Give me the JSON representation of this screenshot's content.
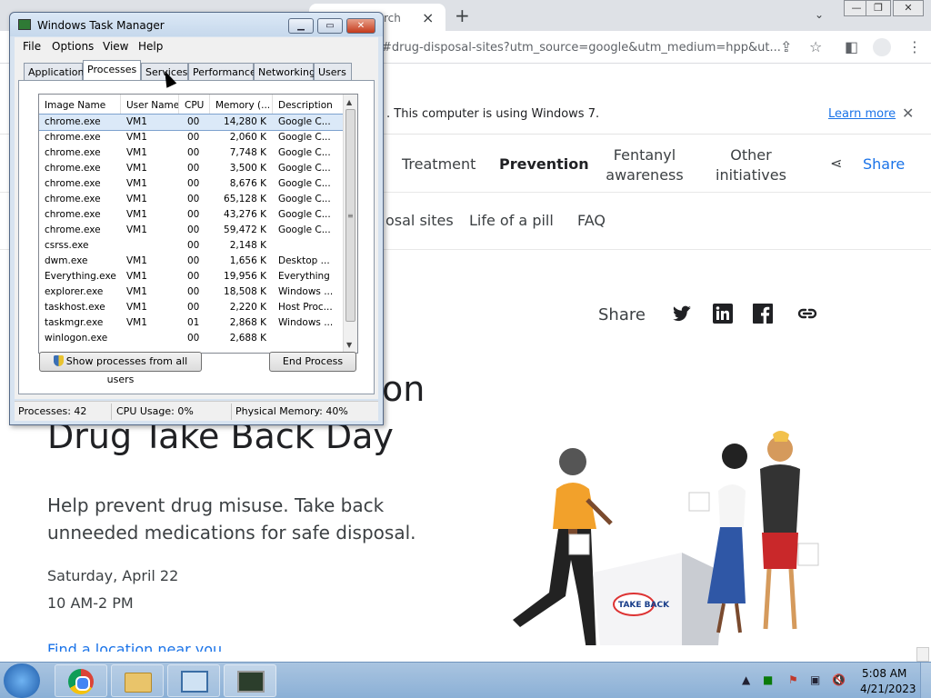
{
  "chrome": {
    "tab_title": "rch",
    "tab_close": "×",
    "new_tab": "+",
    "tab_search": "⌄",
    "win_min": "—",
    "win_restore": "❐",
    "win_close": "✕",
    "url": "#drug-disposal-sites?utm_source=google&utm_medium=hpp&ut...",
    "infobar_text": ". This computer is using Windows 7.",
    "learn_more": "Learn more",
    "infobar_close": "✕"
  },
  "page": {
    "nav": {
      "treatment": "Treatment",
      "prevention": "Prevention",
      "fentanyl": "Fentanyl awareness",
      "other": "Other initiatives",
      "share": "Share"
    },
    "subnav": {
      "disposal": "osal sites",
      "life": "Life of a pill",
      "faq": "FAQ"
    },
    "share_label": "Share",
    "headline_part": "on",
    "headline": "Drug Take Back Day",
    "lead": "Help prevent drug misuse. Take back unneeded medications for safe disposal.",
    "date": "Saturday, April 22",
    "time": "10 AM-2 PM",
    "find_location": "Find a location near you",
    "box_label": "TAKE BACK",
    "colors": {
      "link": "#1a73e8",
      "text": "#202124"
    }
  },
  "taskmgr": {
    "title": "Windows Task Manager",
    "buttons": {
      "min": "▁",
      "max": "▭",
      "close": "✕"
    },
    "menu": {
      "file": "File",
      "options": "Options",
      "view": "View",
      "help": "Help"
    },
    "tabs": {
      "applications": "Applications",
      "processes": "Processes",
      "services": "Services",
      "performance": "Performance",
      "networking": "Networking",
      "users": "Users"
    },
    "columns": {
      "image": "Image Name",
      "user": "User Name",
      "cpu": "CPU",
      "memory": "Memory (...",
      "description": "Description"
    },
    "rows": [
      {
        "name": "chrome.exe",
        "user": "VM1",
        "cpu": "00",
        "mem": "14,280 K",
        "desc": "Google C..."
      },
      {
        "name": "chrome.exe",
        "user": "VM1",
        "cpu": "00",
        "mem": "2,060 K",
        "desc": "Google C..."
      },
      {
        "name": "chrome.exe",
        "user": "VM1",
        "cpu": "00",
        "mem": "7,748 K",
        "desc": "Google C..."
      },
      {
        "name": "chrome.exe",
        "user": "VM1",
        "cpu": "00",
        "mem": "3,500 K",
        "desc": "Google C..."
      },
      {
        "name": "chrome.exe",
        "user": "VM1",
        "cpu": "00",
        "mem": "8,676 K",
        "desc": "Google C..."
      },
      {
        "name": "chrome.exe",
        "user": "VM1",
        "cpu": "00",
        "mem": "65,128 K",
        "desc": "Google C..."
      },
      {
        "name": "chrome.exe",
        "user": "VM1",
        "cpu": "00",
        "mem": "43,276 K",
        "desc": "Google C..."
      },
      {
        "name": "chrome.exe",
        "user": "VM1",
        "cpu": "00",
        "mem": "59,472 K",
        "desc": "Google C..."
      },
      {
        "name": "csrss.exe",
        "user": "",
        "cpu": "00",
        "mem": "2,148 K",
        "desc": ""
      },
      {
        "name": "dwm.exe",
        "user": "VM1",
        "cpu": "00",
        "mem": "1,656 K",
        "desc": "Desktop ..."
      },
      {
        "name": "Everything.exe",
        "user": "VM1",
        "cpu": "00",
        "mem": "19,956 K",
        "desc": "Everything"
      },
      {
        "name": "explorer.exe",
        "user": "VM1",
        "cpu": "00",
        "mem": "18,508 K",
        "desc": "Windows ..."
      },
      {
        "name": "taskhost.exe",
        "user": "VM1",
        "cpu": "00",
        "mem": "2,220 K",
        "desc": "Host Proc..."
      },
      {
        "name": "taskmgr.exe",
        "user": "VM1",
        "cpu": "01",
        "mem": "2,868 K",
        "desc": "Windows ..."
      },
      {
        "name": "winlogon.exe",
        "user": "",
        "cpu": "00",
        "mem": "2,688 K",
        "desc": ""
      }
    ],
    "show_all_label": "Show processes from all users",
    "end_process_label": "End Process",
    "status": {
      "processes": "Processes: 42",
      "cpu": "CPU Usage: 0%",
      "memory": "Physical Memory: 40%"
    }
  },
  "taskbar": {
    "time": "5:08 AM",
    "date": "4/21/2023"
  }
}
